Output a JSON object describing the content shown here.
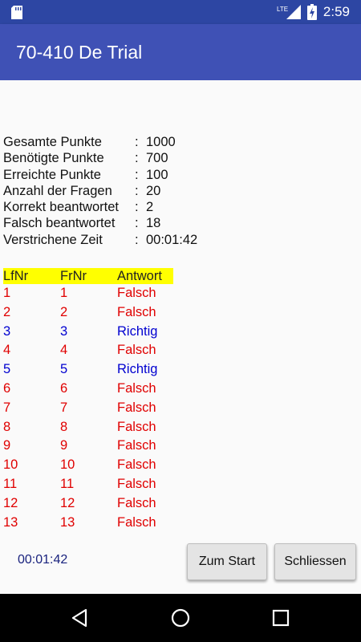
{
  "status_bar": {
    "time": "2:59",
    "network": "LTE",
    "icons": [
      "sd-card-icon",
      "signal-icon",
      "battery-charging-icon"
    ]
  },
  "app_bar": {
    "title": "70-410 De Trial"
  },
  "stats": [
    {
      "label": "Gesamte Punkte",
      "sep": ":",
      "value": "1000"
    },
    {
      "label": "Benötigte Punkte",
      "sep": ":",
      "value": "700"
    },
    {
      "label": "Erreichte Punkte",
      "sep": ":",
      "value": "100"
    },
    {
      "label": "Anzahl der Fragen",
      "sep": ":",
      "value": "20"
    },
    {
      "label": "Korrekt beantwortet",
      "sep": ":",
      "value": "2"
    },
    {
      "label": "Falsch beantwortet",
      "sep": ":",
      "value": "18"
    },
    {
      "label": "Verstrichene Zeit",
      "sep": ":",
      "value": "00:01:42"
    }
  ],
  "table": {
    "headers": [
      "LfNr",
      "FrNr",
      "Antwort"
    ],
    "rows": [
      [
        "1",
        "1",
        "Falsch"
      ],
      [
        "2",
        "2",
        "Falsch"
      ],
      [
        "3",
        "3",
        "Richtig"
      ],
      [
        "4",
        "4",
        "Falsch"
      ],
      [
        "5",
        "5",
        "Richtig"
      ],
      [
        "6",
        "6",
        "Falsch"
      ],
      [
        "7",
        "7",
        "Falsch"
      ],
      [
        "8",
        "8",
        "Falsch"
      ],
      [
        "9",
        "9",
        "Falsch"
      ],
      [
        "10",
        "10",
        "Falsch"
      ],
      [
        "11",
        "11",
        "Falsch"
      ],
      [
        "12",
        "12",
        "Falsch"
      ],
      [
        "13",
        "13",
        "Falsch"
      ]
    ]
  },
  "footer": {
    "timer": "00:01:42",
    "start_button": "Zum Start",
    "close_button": "Schliessen"
  },
  "colors": {
    "app_bar": "#3f51b5",
    "status_bar": "#2d46a3",
    "header_highlight": "#ffff00",
    "wrong": "#e00000",
    "right": "#0000d0"
  },
  "nav_bar": {
    "icons": [
      "back-icon",
      "home-icon",
      "recents-icon"
    ]
  }
}
